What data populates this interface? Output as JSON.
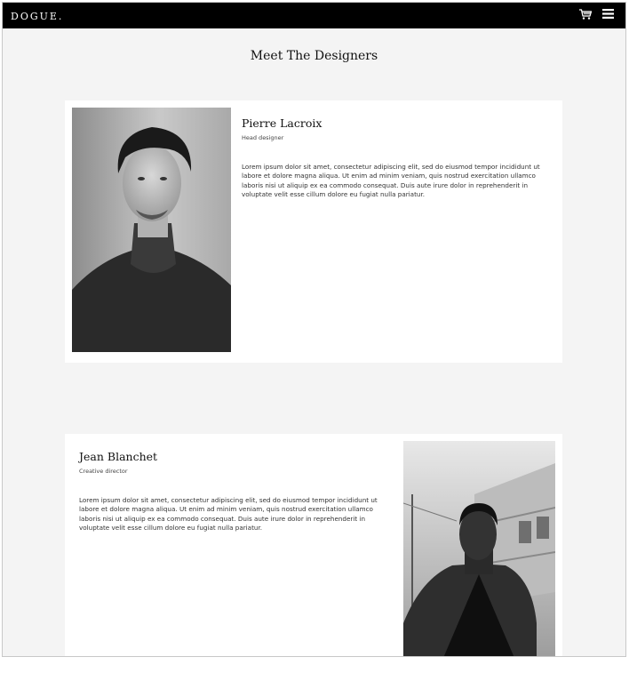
{
  "navbar": {
    "logo": "DOGUE.",
    "cart_icon": "cart-icon",
    "menu_icon": "hamburger-menu-icon",
    "background": "#000000"
  },
  "page": {
    "title": "Meet The Designers",
    "background": "#f4f4f4"
  },
  "designers": [
    {
      "name": "Pierre Lacroix",
      "role": "Head designer",
      "bio": "Lorem ipsum dolor sit amet, consectetur adipiscing elit, sed do eiusmod tempor incididunt ut labore et dolore magna aliqua. Ut enim ad minim veniam, quis nostrud exercitation ullamco laboris nisi ut aliquip ex ea commodo consequat. Duis aute irure dolor in reprehenderit in voluptate velit esse cillum dolore eu fugiat nulla pariatur.",
      "photo": "black-and-white portrait photo"
    },
    {
      "name": "Jean Blanchet",
      "role": "Creative director",
      "bio": "Lorem ipsum dolor sit amet, consectetur adipiscing elit, sed do eiusmod tempor incididunt ut labore et dolore magna aliqua. Ut enim ad minim veniam, quis nostrud exercitation ullamco laboris nisi ut aliquip ex ea commodo consequat. Duis aute irure dolor in reprehenderit in voluptate velit esse cillum dolore eu fugiat nulla pariatur.",
      "photo": "black-and-white portrait photo"
    }
  ]
}
